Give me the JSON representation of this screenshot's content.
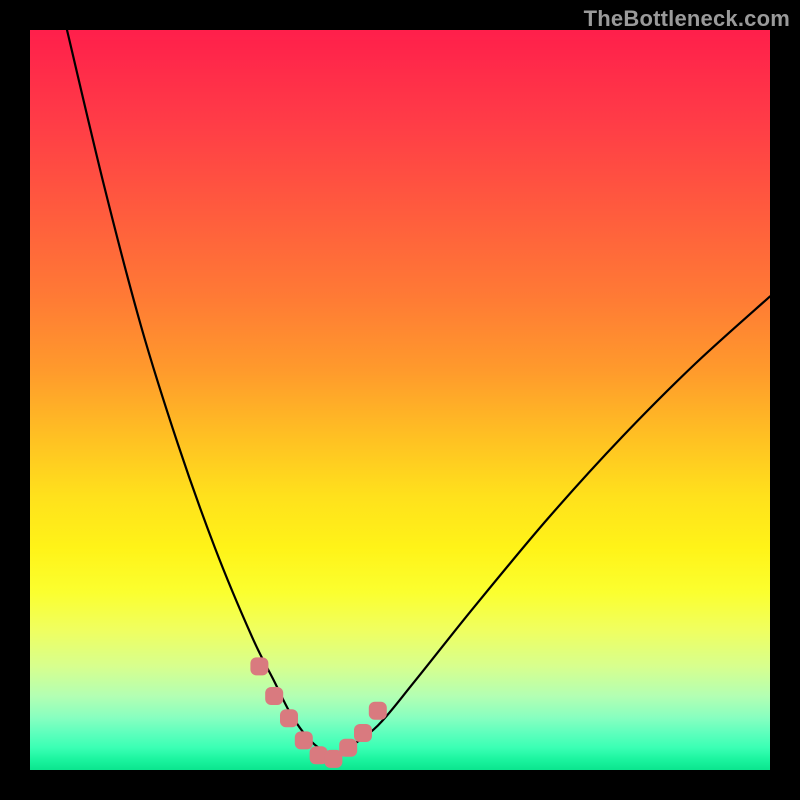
{
  "watermark": {
    "text": "TheBottleneck.com"
  },
  "colors": {
    "page_bg": "#000000",
    "curve": "#000000",
    "marker": "#d97a7f",
    "gradient_top": "#ff1f4b",
    "gradient_bottom": "#0be58e"
  },
  "chart_data": {
    "type": "line",
    "title": "",
    "xlabel": "",
    "ylabel": "",
    "xlim": [
      0,
      100
    ],
    "ylim": [
      0,
      100
    ],
    "grid": false,
    "legend": false,
    "annotations": [],
    "series": [
      {
        "name": "bottleneck-curve",
        "x": [
          5,
          10,
          15,
          20,
          25,
          30,
          33,
          35,
          37,
          39,
          41,
          43,
          47,
          52,
          60,
          70,
          80,
          90,
          100
        ],
        "y": [
          100,
          79,
          60,
          44,
          30,
          18,
          12,
          8,
          5,
          3,
          2,
          3,
          6,
          12,
          22,
          34,
          45,
          55,
          64
        ]
      }
    ],
    "markers": {
      "name": "highlight-points",
      "shape": "rounded-rect",
      "color": "#d97a7f",
      "x": [
        31,
        33,
        35,
        37,
        39,
        41,
        43,
        45,
        47
      ],
      "y": [
        14,
        10,
        7,
        4,
        2,
        1.5,
        3,
        5,
        8
      ]
    }
  }
}
